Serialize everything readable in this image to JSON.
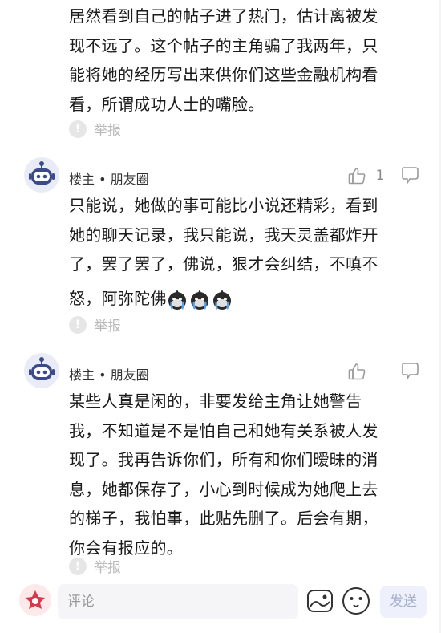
{
  "comments": [
    {
      "author": "",
      "likes": "",
      "lines": [
        "居然看到自己的帖子进了热门，估计离被发",
        "现不远了。这个帖子的主角骗了我两年，只",
        "能将她的经历写出来供你们这些金融机构看",
        "看，所谓成功人士的嘴脸。"
      ],
      "report_label": "举报"
    },
    {
      "author": "楼主 • 朋友圈",
      "likes": "1",
      "lines": [
        "只能说，她做的事可能比小说还精彩，看到",
        "她的聊天记录，我只能说，我天灵盖都炸开",
        "了，罢了罢了，佛说，狠才会纠结，不嗔不",
        "怒，阿弥陀佛"
      ],
      "emojis": [
        "crying-emoji",
        "crying-emoji",
        "crying-emoji"
      ],
      "report_label": "举报"
    },
    {
      "author": "楼主 • 朋友圈",
      "likes": "",
      "lines": [
        "某些人真是闲的，非要发给主角让她警告",
        "我，不知道是不是怕自己和她有关系被人发",
        "现了。我再告诉你们，所有和你们暧昧的消",
        "息，她都保存了，小心到时候成为她爬上去",
        "的梯子，我怕事，此贴先删了。后会有期，",
        "你会有报应的。"
      ],
      "report_label": "举报"
    }
  ],
  "bottom_bar": {
    "input_placeholder": "评论",
    "send_label": "发送"
  },
  "colors": {
    "accent_avatar": "#3b4a8c",
    "muted": "#b9b9b9"
  }
}
